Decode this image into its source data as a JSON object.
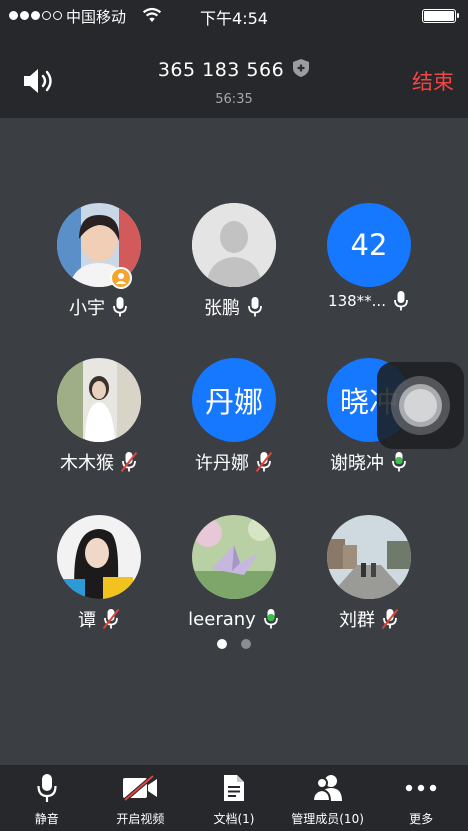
{
  "status_bar": {
    "carrier": "中国移动",
    "time": "下午4:54"
  },
  "header": {
    "meeting_id": "365 183 566",
    "duration": "56:35",
    "end_label": "结束"
  },
  "participants": [
    {
      "name": "小宇",
      "avatar": "photo-boy-red",
      "mic": "on",
      "host": true
    },
    {
      "name": "张鹏",
      "avatar": "default-silhouette",
      "mic": "on"
    },
    {
      "name": "138**...",
      "avatar_text": "42",
      "avatar": "blue-text",
      "mic": "on"
    },
    {
      "name": "木木猴",
      "avatar": "photo-girl-white-dress",
      "mic": "muted"
    },
    {
      "name": "许丹娜",
      "avatar_text": "丹娜",
      "avatar": "blue-text",
      "mic": "muted"
    },
    {
      "name": "谢晓冲",
      "avatar_text": "晓冲",
      "avatar": "blue-text",
      "mic": "active"
    },
    {
      "name": "谭",
      "avatar": "photo-woman-portrait",
      "mic": "muted"
    },
    {
      "name": "leerany",
      "avatar": "photo-paper-crane",
      "mic": "active"
    },
    {
      "name": "刘群",
      "avatar": "photo-couple-street",
      "mic": "muted"
    }
  ],
  "pagination": {
    "current": 1,
    "total": 2
  },
  "toolbar": {
    "mute": "静音",
    "video": "开启视频",
    "docs": "文档(1)",
    "members": "管理成员(10)",
    "more": "更多"
  },
  "colors": {
    "end": "#f04646",
    "accent_blue": "#1677ff",
    "mic_active": "#38c24a",
    "mic_muted": "#e0433a",
    "host_badge": "#f2a530"
  },
  "icons": {
    "speaker": "speaker-icon",
    "shield": "shield-plus-icon",
    "mic": "microphone-icon",
    "video_off": "video-off-icon",
    "document": "document-icon",
    "members": "members-icon",
    "more": "more-dots-icon"
  }
}
